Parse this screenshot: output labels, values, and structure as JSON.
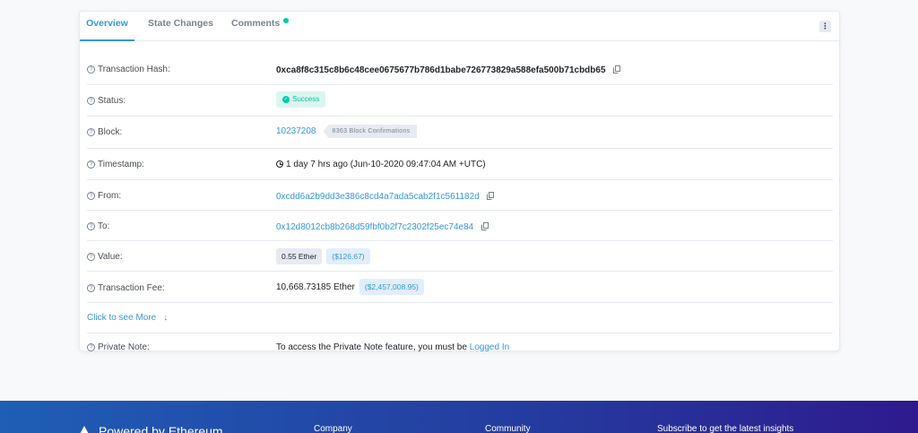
{
  "tabs": {
    "overview": "Overview",
    "state_changes": "State Changes",
    "comments": "Comments",
    "more": "⋮"
  },
  "rows": {
    "hash": {
      "label": "Transaction Hash:",
      "value": "0xca8f8c315c8b6c48cee0675677b786d1babe726773829a588efa500b71cbdb65"
    },
    "status": {
      "label": "Status:",
      "value": "Success"
    },
    "block": {
      "label": "Block:",
      "value": "10237208",
      "confirmations": "8363 Block Confirmations"
    },
    "timestamp": {
      "label": "Timestamp:",
      "value": "1 day 7 hrs ago (Jun-10-2020 09:47:04 AM +UTC)"
    },
    "from": {
      "label": "From:",
      "value": "0xcdd6a2b9dd3e386c8cd4a7ada5cab2f1c561182d"
    },
    "to": {
      "label": "To:",
      "value": "0x12d8012cb8b268d59fbf0b2f7c2302f25ec74e84"
    },
    "value": {
      "label": "Value:",
      "ether": "0.55 Ether",
      "usd": "($126.67)"
    },
    "fee": {
      "label": "Transaction Fee:",
      "ether": "10,668.73185 Ether",
      "usd": "($2,457,008.95)"
    },
    "see_more": "Click to see More",
    "private_note": {
      "label": "Private Note:",
      "text": "To access the Private Note feature, you must be",
      "link": "Logged In"
    }
  },
  "footer": {
    "brand": "Powered by Ethereum",
    "company": "Company",
    "community": "Community",
    "subscribe": "Subscribe to get the latest insights"
  },
  "colors": {
    "accent": "#3498db",
    "success": "#00c9a7",
    "footer_start": "#1f5eb5",
    "footer_end": "#2e1a8e"
  }
}
